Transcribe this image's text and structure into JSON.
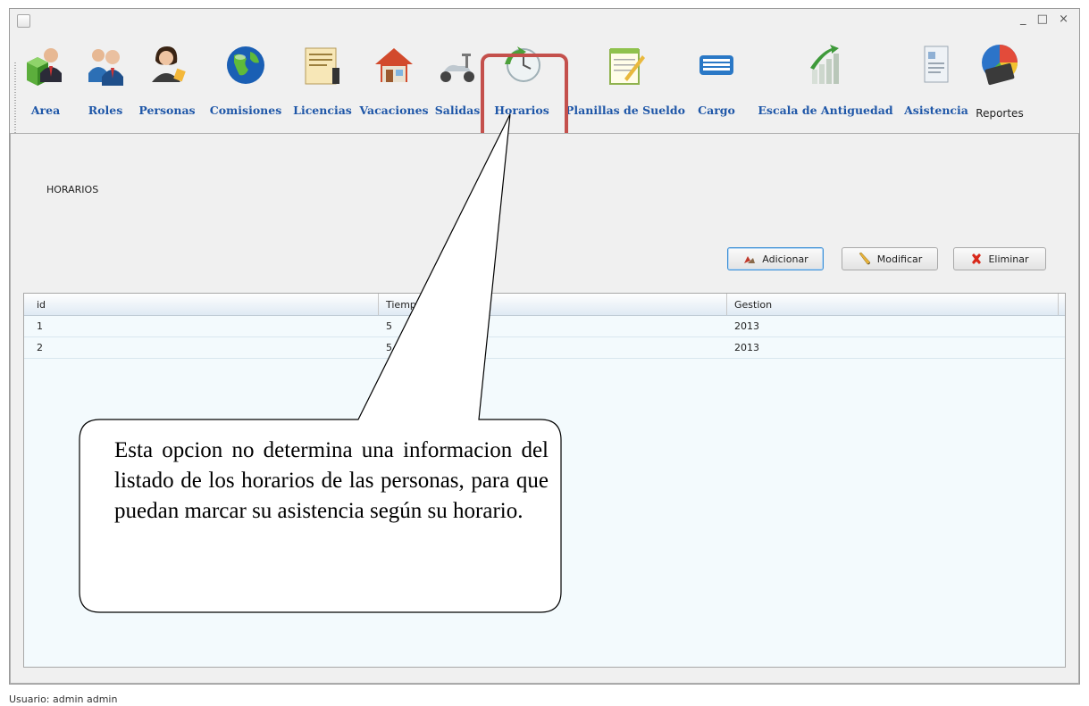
{
  "window": {
    "controls": "_ □ ×"
  },
  "toolbar": {
    "items": [
      {
        "label": "Area",
        "icon": "area-users-icon"
      },
      {
        "label": "Roles",
        "icon": "roles-users-icon"
      },
      {
        "label": "Personas",
        "icon": "person-icon"
      },
      {
        "label": "Comisiones",
        "icon": "globe-icon"
      },
      {
        "label": "Licencias",
        "icon": "document-icon"
      },
      {
        "label": "Vacaciones",
        "icon": "house-icon"
      },
      {
        "label": "Salidas",
        "icon": "scooter-icon"
      },
      {
        "label": "Horarios",
        "icon": "clock-icon"
      },
      {
        "label": "Planillas de Sueldo",
        "icon": "notepad-icon"
      },
      {
        "label": "Cargo",
        "icon": "keyboard-icon"
      },
      {
        "label": "Escala de Antiguedad",
        "icon": "bar-chart-icon"
      },
      {
        "label": "Asistencia",
        "icon": "report-doc-icon"
      },
      {
        "label": "Reportes",
        "icon": "pie-calculator-icon"
      }
    ]
  },
  "panel": {
    "title": "HORARIOS",
    "buttons": {
      "add": "Adicionar",
      "edit": "Modificar",
      "delete": "Eliminar"
    }
  },
  "table": {
    "columns": [
      "id",
      "Tiemp",
      "Gestion"
    ],
    "rows": [
      {
        "id": "1",
        "tiempo": "5",
        "gestion": "2013"
      },
      {
        "id": "2",
        "tiempo": "5",
        "gestion": "2013"
      }
    ]
  },
  "callout": {
    "text": "Esta opcion no determina una informacion del listado de los horarios de las personas, para que puedan marcar su asistencia según su horario."
  },
  "status": {
    "user": "Usuario: admin admin"
  },
  "colors": {
    "label_blue": "#1f57a8",
    "highlight_red": "#c4504c",
    "grid_bg": "#f3fafd"
  }
}
